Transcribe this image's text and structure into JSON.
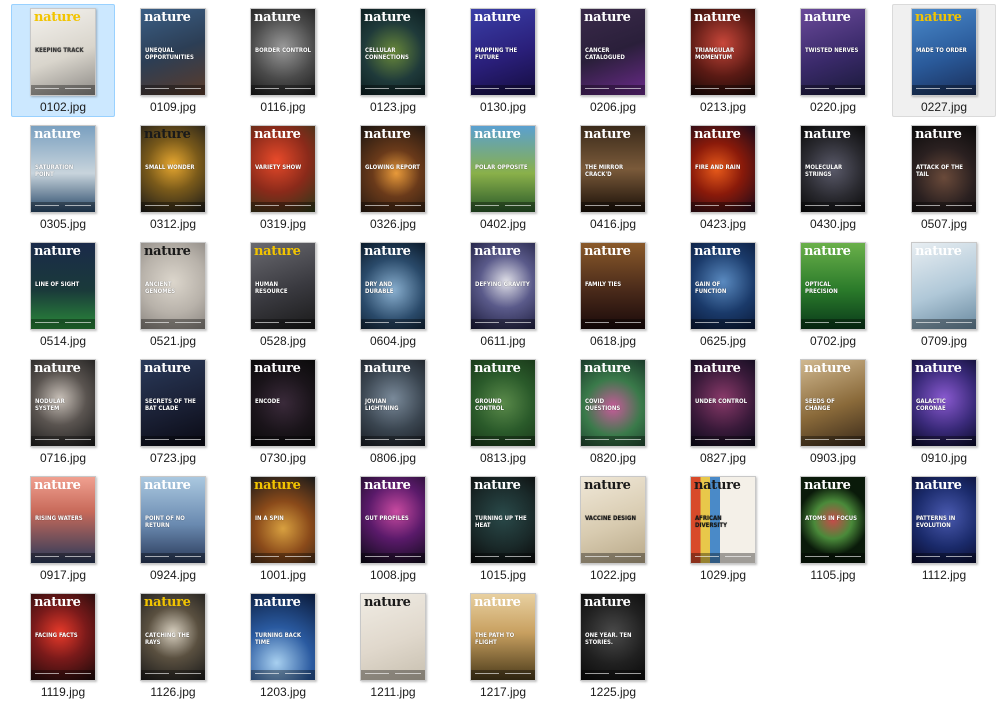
{
  "items": [
    {
      "name": "0102.jpg",
      "bg": "linear-gradient(160deg,#f4f2ee,#d9d5cc 55%,#8d8a86)",
      "mast": "#f2c400",
      "headline": "KEEPING TRACK",
      "hl": "#3a3a3a",
      "state": "sel"
    },
    {
      "name": "0109.jpg",
      "bg": "linear-gradient(160deg,#3b5f86,#2c3e55 50%,#5a3b2a)",
      "mast": "#ffffff",
      "headline": "UNEQUAL OPPORTUNITIES",
      "hl": "#ffffff"
    },
    {
      "name": "0116.jpg",
      "bg": "radial-gradient(circle at 50% 45%,#9a9a9a,#4a4a4a 55%,#1c1c1c)",
      "mast": "#ffffff",
      "headline": "BORDER CONTROL",
      "hl": "#ffffff"
    },
    {
      "name": "0123.jpg",
      "bg": "radial-gradient(circle at 50% 50%,#6a8a3a,#1f3a3a 55%,#0d1f22)",
      "mast": "#ffffff",
      "headline": "CELLULAR CONNECTIONS",
      "hl": "#ffffff"
    },
    {
      "name": "0130.jpg",
      "bg": "linear-gradient(160deg,#3a3fa8,#2a1f7a 55%,#150d40)",
      "mast": "#ffffff",
      "headline": "MAPPING THE FUTURE",
      "hl": "#ffffff"
    },
    {
      "name": "0206.jpg",
      "bg": "linear-gradient(160deg,#3a2a4a,#2a1f3a 50%,#6a2a8a)",
      "mast": "#ffffff",
      "headline": "CANCER CATALOGUED",
      "hl": "#ffffff"
    },
    {
      "name": "0213.jpg",
      "bg": "radial-gradient(circle at 50% 40%,#c8473a,#5a1a14 55%,#1a0a08)",
      "mast": "#ffffff",
      "headline": "TRIANGULAR MOMENTUM",
      "hl": "#ffffff"
    },
    {
      "name": "0220.jpg",
      "bg": "linear-gradient(160deg,#6a4a9a,#3a2a6a 55%,#1a1a3a)",
      "mast": "#ffffff",
      "headline": "TWISTED NERVES",
      "hl": "#ffffff"
    },
    {
      "name": "0227.jpg",
      "bg": "linear-gradient(160deg,#4a8acb,#2a5a9a 55%,#1a2f5a)",
      "mast": "#f2c400",
      "headline": "MADE TO ORDER",
      "hl": "#ffffff",
      "state": "hov"
    },
    {
      "name": "0305.jpg",
      "bg": "linear-gradient(180deg,#7aa0c0,#c8d4dc 55%,#2a4a6a)",
      "mast": "#ffffff",
      "headline": "SATURATION POINT",
      "hl": "#ffffff"
    },
    {
      "name": "0312.jpg",
      "bg": "radial-gradient(circle at 50% 45%,#e8a830,#7a5a1a 45%,#1a1a1a)",
      "mast": "#1a1a1a",
      "headline": "SMALL WONDER",
      "hl": "#ffffff"
    },
    {
      "name": "0319.jpg",
      "bg": "radial-gradient(circle at 40% 40%,#e84a2a,#8a2a1a 50%,#2a3a1a)",
      "mast": "#ffffff",
      "headline": "VARIETY SHOW",
      "hl": "#ffffff"
    },
    {
      "name": "0326.jpg",
      "bg": "radial-gradient(circle at 55% 55%,#e89a3a,#6a3a1a 40%,#1a1410)",
      "mast": "#ffffff",
      "headline": "GLOWING REPORT",
      "hl": "#ffffff"
    },
    {
      "name": "0402.jpg",
      "bg": "linear-gradient(180deg,#5aa0d0,#8ab04a 55%,#2a5a2a)",
      "mast": "#ffffff",
      "headline": "POLAR OPPOSITE",
      "hl": "#ffffff"
    },
    {
      "name": "0416.jpg",
      "bg": "linear-gradient(180deg,#3a2a1a,#7a5a3a 50%,#1a1008)",
      "mast": "#ffffff",
      "headline": "THE MIRROR CRACK'D",
      "hl": "#ffffff"
    },
    {
      "name": "0423.jpg",
      "bg": "radial-gradient(circle at 40% 50%,#e85a1a,#8a1a0a 45%,#1a0a1a)",
      "mast": "#ffffff",
      "headline": "FIRE AND RAIN",
      "hl": "#ffffff"
    },
    {
      "name": "0430.jpg",
      "bg": "radial-gradient(circle at 50% 50%,#5a5a6a,#2a2a30 55%,#0a0a0a)",
      "mast": "#ffffff",
      "headline": "MOLECULAR STRINGS",
      "hl": "#ffffff"
    },
    {
      "name": "0507.jpg",
      "bg": "radial-gradient(circle at 50% 60%,#6a4a3a,#2a2020 50%,#0a0a0a)",
      "mast": "#ffffff",
      "headline": "ATTACK OF THE TAIL",
      "hl": "#ffffff"
    },
    {
      "name": "0514.jpg",
      "bg": "linear-gradient(180deg,#1a2a4a,#1a3a3a 55%,#2a8a3a)",
      "mast": "#ffffff",
      "headline": "LINE OF SIGHT",
      "hl": "#ffffff"
    },
    {
      "name": "0521.jpg",
      "bg": "radial-gradient(circle at 50% 45%,#dcd6cc,#b8b2aa 55%,#8a8580)",
      "mast": "#1a1a1a",
      "headline": "ANCIENT GENOMES",
      "hl": "#ffffff"
    },
    {
      "name": "0528.jpg",
      "bg": "linear-gradient(160deg,#6a6a70,#3a3a40 55%,#1a1a1a)",
      "mast": "#f2c400",
      "headline": "HUMAN RESOURCE",
      "hl": "#ffffff"
    },
    {
      "name": "0604.jpg",
      "bg": "radial-gradient(circle at 50% 55%,#8ab0d0,#2a4a6a 55%,#0a1a2a)",
      "mast": "#ffffff",
      "headline": "DRY AND DURABLE",
      "hl": "#ffffff"
    },
    {
      "name": "0611.jpg",
      "bg": "radial-gradient(circle at 55% 45%,#e0e0e8,#5a5a8a 45%,#1a1a3a)",
      "mast": "#ffffff",
      "headline": "DEFYING GRAVITY",
      "hl": "#ffffff"
    },
    {
      "name": "0618.jpg",
      "bg": "linear-gradient(180deg,#8a5a2a,#4a2a1a 55%,#1a0a0a)",
      "mast": "#ffffff",
      "headline": "FAMILY TIES",
      "hl": "#ffffff"
    },
    {
      "name": "0625.jpg",
      "bg": "radial-gradient(circle at 50% 45%,#5a8ac0,#1a3a6a 55%,#0a1a3a)",
      "mast": "#ffffff",
      "headline": "GAIN OF FUNCTION",
      "hl": "#ffffff"
    },
    {
      "name": "0702.jpg",
      "bg": "linear-gradient(180deg,#6ab04a,#2a7a2a 55%,#0a3a1a)",
      "mast": "#ffffff",
      "headline": "OPTICAL PRECISION",
      "hl": "#ffffff"
    },
    {
      "name": "0709.jpg",
      "bg": "linear-gradient(160deg,#e8eef2,#b0c8d8 55%,#6a8aa0)",
      "mast": "#ffffff",
      "headline": "",
      "hl": "#ffffff"
    },
    {
      "name": "0716.jpg",
      "bg": "radial-gradient(circle at 45% 45%,#c8c0b8,#5a5450 45%,#1a1a1a)",
      "mast": "#ffffff",
      "headline": "NODULAR SYSTEM",
      "hl": "#ffffff"
    },
    {
      "name": "0723.jpg",
      "bg": "linear-gradient(160deg,#2a3a5a,#1a2035 55%,#0a0a14)",
      "mast": "#ffffff",
      "headline": "SECRETS OF THE BAT CLADE",
      "hl": "#ffffff"
    },
    {
      "name": "0730.jpg",
      "bg": "radial-gradient(circle at 50% 50%,#3a2a3a,#1a141a 55%,#0a0a0a)",
      "mast": "#ffffff",
      "headline": "ENCODE",
      "hl": "#ffffff"
    },
    {
      "name": "0806.jpg",
      "bg": "radial-gradient(circle at 50% 45%,#7a8a9a,#3a4550 55%,#1a1e24)",
      "mast": "#ffffff",
      "headline": "JOVIAN LIGHTNING",
      "hl": "#ffffff"
    },
    {
      "name": "0813.jpg",
      "bg": "radial-gradient(circle at 50% 50%,#5a8a4a,#2a5a2a 55%,#1a3a1a)",
      "mast": "#ffffff",
      "headline": "GROUND CONTROL",
      "hl": "#ffffff"
    },
    {
      "name": "0820.jpg",
      "bg": "radial-gradient(circle at 50% 55%,#c85a9a,#3a7a4a 50%,#1a3a2a)",
      "mast": "#ffffff",
      "headline": "COVID QUESTIONS",
      "hl": "#ffffff"
    },
    {
      "name": "0827.jpg",
      "bg": "radial-gradient(circle at 50% 45%,#8a3a6a,#3a1a3a 55%,#0a0a1a)",
      "mast": "#ffffff",
      "headline": "UNDER CONTROL",
      "hl": "#ffffff"
    },
    {
      "name": "0903.jpg",
      "bg": "linear-gradient(160deg,#d0b890,#8a6a3a 55%,#3a2a1a)",
      "mast": "#ffffff",
      "headline": "SEEDS OF CHANGE",
      "hl": "#ffffff"
    },
    {
      "name": "0910.jpg",
      "bg": "radial-gradient(circle at 50% 45%,#8a5ad0,#3a2a7a 55%,#0a0a2a)",
      "mast": "#ffffff",
      "headline": "GALACTIC CORONAE",
      "hl": "#ffffff"
    },
    {
      "name": "0917.jpg",
      "bg": "linear-gradient(180deg,#f0a090,#c86a5a 40%,#2a3a5a)",
      "mast": "#ffffff",
      "headline": "RISING WATERS",
      "hl": "#ffffff"
    },
    {
      "name": "0924.jpg",
      "bg": "linear-gradient(180deg,#aac8e0,#6a8ab0 55%,#2a3a5a)",
      "mast": "#ffffff",
      "headline": "POINT OF NO RETURN",
      "hl": "#ffffff"
    },
    {
      "name": "1001.jpg",
      "bg": "radial-gradient(circle at 50% 60%,#d8a040,#8a4a1a 45%,#1a1a1a)",
      "mast": "#f2c400",
      "headline": "IN A SPIN",
      "hl": "#ffffff"
    },
    {
      "name": "1008.jpg",
      "bg": "radial-gradient(circle at 55% 40%,#c84aa0,#5a1a6a 45%,#0a0a14)",
      "mast": "#ffffff",
      "headline": "GUT PROFILES",
      "hl": "#ffffff"
    },
    {
      "name": "1015.jpg",
      "bg": "radial-gradient(circle at 50% 45%,#2a4a4a,#1a2a2a 55%,#0a0a0a)",
      "mast": "#ffffff",
      "headline": "TURNING UP THE HEAT",
      "hl": "#ffffff"
    },
    {
      "name": "1022.jpg",
      "bg": "linear-gradient(160deg,#f0e8d8,#d8cbb0 55%,#b8a888)",
      "mast": "#1a1a1a",
      "headline": "VACCINE DESIGN",
      "hl": "#1a1a1a"
    },
    {
      "name": "1029.jpg",
      "bg": "linear-gradient(90deg,#d84a2a 0 15%,#e8c84a 15% 30%,#4a8ac8 30% 45%,#f4f0e8 45% 100%)",
      "mast": "#1a1a1a",
      "headline": "AFRICAN DIVERSITY",
      "hl": "#1a1a1a"
    },
    {
      "name": "1105.jpg",
      "bg": "radial-gradient(circle at 50% 50%,#c84a4a,#4a8a3a 35%,#0a1a0a 65%)",
      "mast": "#ffffff",
      "headline": "ATOMS IN FOCUS",
      "hl": "#ffffff"
    },
    {
      "name": "1112.jpg",
      "bg": "radial-gradient(circle at 55% 45%,#4a5ab0,#1a2a6a 55%,#0a0a2a)",
      "mast": "#ffffff",
      "headline": "PATTERNS IN EVOLUTION",
      "hl": "#ffffff"
    },
    {
      "name": "1119.jpg",
      "bg": "radial-gradient(circle at 45% 45%,#e83a2a,#7a1a1a 45%,#1a0a0a)",
      "mast": "#ffffff",
      "headline": "FACING FACTS",
      "hl": "#ffffff"
    },
    {
      "name": "1126.jpg",
      "bg": "radial-gradient(circle at 50% 45%,#d8d0c0,#5a5040 45%,#1a1a1a)",
      "mast": "#f2c400",
      "headline": "CATCHING THE RAYS",
      "hl": "#ffffff"
    },
    {
      "name": "1203.jpg",
      "bg": "radial-gradient(circle at 40% 80%,#a8d0f0,#2a5aa0 45%,#0a1a3a)",
      "mast": "#ffffff",
      "headline": "TURNING BACK TIME",
      "hl": "#ffffff"
    },
    {
      "name": "1211.jpg",
      "bg": "linear-gradient(160deg,#f0ece4,#e0d8cc 55%,#c8c0b0)",
      "mast": "#1a1a1a",
      "headline": "",
      "hl": "#1a1a1a"
    },
    {
      "name": "1217.jpg",
      "bg": "linear-gradient(180deg,#e8d0a0,#c8a060 45%,#4a3a1a)",
      "mast": "#ffffff",
      "headline": "THE PATH TO FLIGHT",
      "hl": "#ffffff"
    },
    {
      "name": "1225.jpg",
      "bg": "radial-gradient(circle at 50% 45%,#4a4a4a,#202020 55%,#0a0a0a)",
      "mast": "#ffffff",
      "headline": "ONE YEAR. TEN STORIES.",
      "hl": "#ffffff"
    }
  ]
}
